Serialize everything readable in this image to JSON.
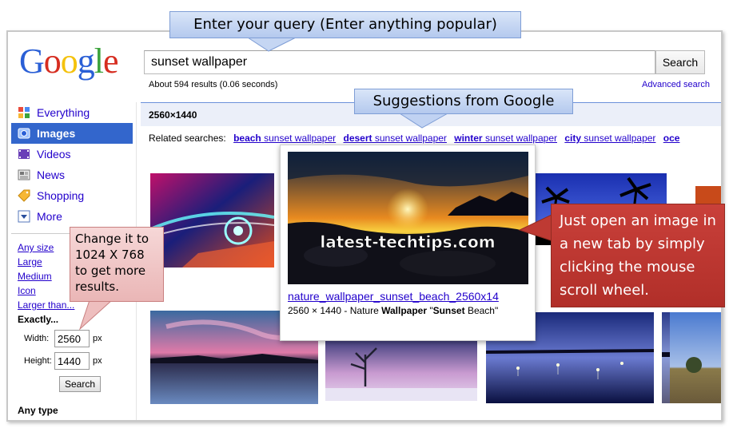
{
  "logo": {
    "letters": [
      {
        "ch": "G",
        "color": "#2a5fd6"
      },
      {
        "ch": "o",
        "color": "#d62d20"
      },
      {
        "ch": "o",
        "color": "#f4c20d"
      },
      {
        "ch": "g",
        "color": "#2a5fd6"
      },
      {
        "ch": "l",
        "color": "#3ca33c"
      },
      {
        "ch": "e",
        "color": "#d62d20"
      }
    ]
  },
  "search": {
    "value": "sunset wallpaper",
    "button_label": "Search",
    "stats": "About 594 results (0.06 seconds)",
    "advanced_link": "Advanced search"
  },
  "nav": {
    "items": [
      {
        "label": "Everything",
        "icon": "everything-icon",
        "active": false
      },
      {
        "label": "Images",
        "icon": "images-icon",
        "active": true
      },
      {
        "label": "Videos",
        "icon": "videos-icon",
        "active": false
      },
      {
        "label": "News",
        "icon": "news-icon",
        "active": false
      },
      {
        "label": "Shopping",
        "icon": "shopping-icon",
        "active": false
      },
      {
        "label": "More",
        "icon": "more-dropdown-icon",
        "active": false
      }
    ],
    "sizes": [
      "Any size",
      "Large",
      "Medium",
      "Icon",
      "Larger than..."
    ],
    "exactly": "Exactly...",
    "width_label": "Width:",
    "width_value": "2560",
    "height_label": "Height:",
    "height_value": "1440",
    "unit": "px",
    "exact_search_button": "Search",
    "any_type": "Any type"
  },
  "results": {
    "bar_label": "2560×1440",
    "related_prefix": "Related searches:",
    "related": [
      {
        "bold": "beach",
        "rest": " sunset wallpaper"
      },
      {
        "bold": "desert",
        "rest": " sunset wallpaper"
      },
      {
        "bold": "winter",
        "rest": " sunset wallpaper"
      },
      {
        "bold": "city",
        "rest": " sunset wallpaper"
      },
      {
        "bold": "oce",
        "rest": ""
      }
    ]
  },
  "preview": {
    "watermark": "latest-techtips.com",
    "link": "nature_wallpaper_sunset_beach_2560x14",
    "meta_prefix": "2560 × 1440 - Nature ",
    "meta_bold1": "Wallpaper",
    "meta_mid": " \"",
    "meta_bold2": "Sunset",
    "meta_suffix": " Beach\""
  },
  "callouts": {
    "query": "Enter your query (Enter anything popular)",
    "suggest": "Suggestions from Google",
    "tab": "Just open an image in a new tab by simply clicking the mouse scroll wheel.",
    "change": "Change it to 1024 X 768 to get more results."
  },
  "colors": {
    "accent": "#3366cc",
    "link": "#2200cc",
    "red_callout": "#c0392b"
  }
}
